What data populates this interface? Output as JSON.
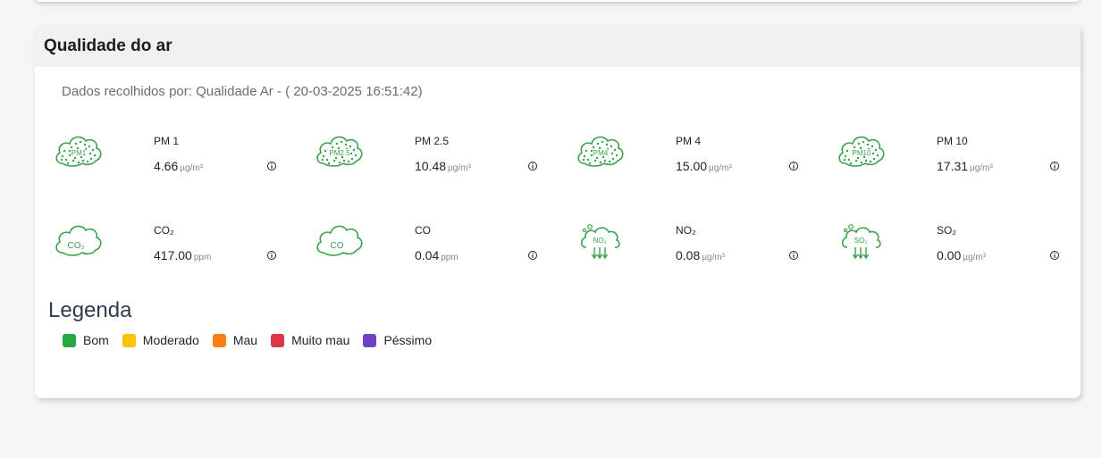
{
  "card": {
    "title": "Qualidade do ar",
    "collected_text": "Dados recolhidos por: Qualidade Ar - ( 20-03-2025 16:51:42)"
  },
  "sensors": [
    {
      "name": "PM 1",
      "value": "4.66",
      "unit": "µg/m³",
      "icon": "pm-cloud-icon",
      "icon_label": "PM1"
    },
    {
      "name": "PM 2.5",
      "value": "10.48",
      "unit": "µg/m³",
      "icon": "pm-cloud-icon",
      "icon_label": "PM2.5"
    },
    {
      "name": "PM 4",
      "value": "15.00",
      "unit": "µg/m³",
      "icon": "pm-cloud-icon",
      "icon_label": "PM4"
    },
    {
      "name": "PM 10",
      "value": "17.31",
      "unit": "µg/m³",
      "icon": "pm-cloud-icon",
      "icon_label": "PM10"
    },
    {
      "name": "CO₂",
      "value": "417.00",
      "unit": "ppm",
      "icon": "gas-cloud-icon",
      "icon_label": "CO₂"
    },
    {
      "name": "CO",
      "value": "0.04",
      "unit": "ppm",
      "icon": "gas-cloud-icon",
      "icon_label": "CO"
    },
    {
      "name": "NO₂",
      "value": "0.08",
      "unit": "µg/m³",
      "icon": "gas-arrows-icon",
      "icon_label": "NO₂"
    },
    {
      "name": "SO₂",
      "value": "0.00",
      "unit": "µg/m³",
      "icon": "gas-arrows-icon",
      "icon_label": "SO₂"
    }
  ],
  "icon_color": "#3aa14a",
  "legend": {
    "title": "Legenda",
    "items": [
      {
        "label": "Bom",
        "color": "#28a745"
      },
      {
        "label": "Moderado",
        "color": "#ffc107"
      },
      {
        "label": "Mau",
        "color": "#fd7e14"
      },
      {
        "label": "Muito mau",
        "color": "#dc3545"
      },
      {
        "label": "Péssimo",
        "color": "#6f42c1"
      }
    ]
  }
}
